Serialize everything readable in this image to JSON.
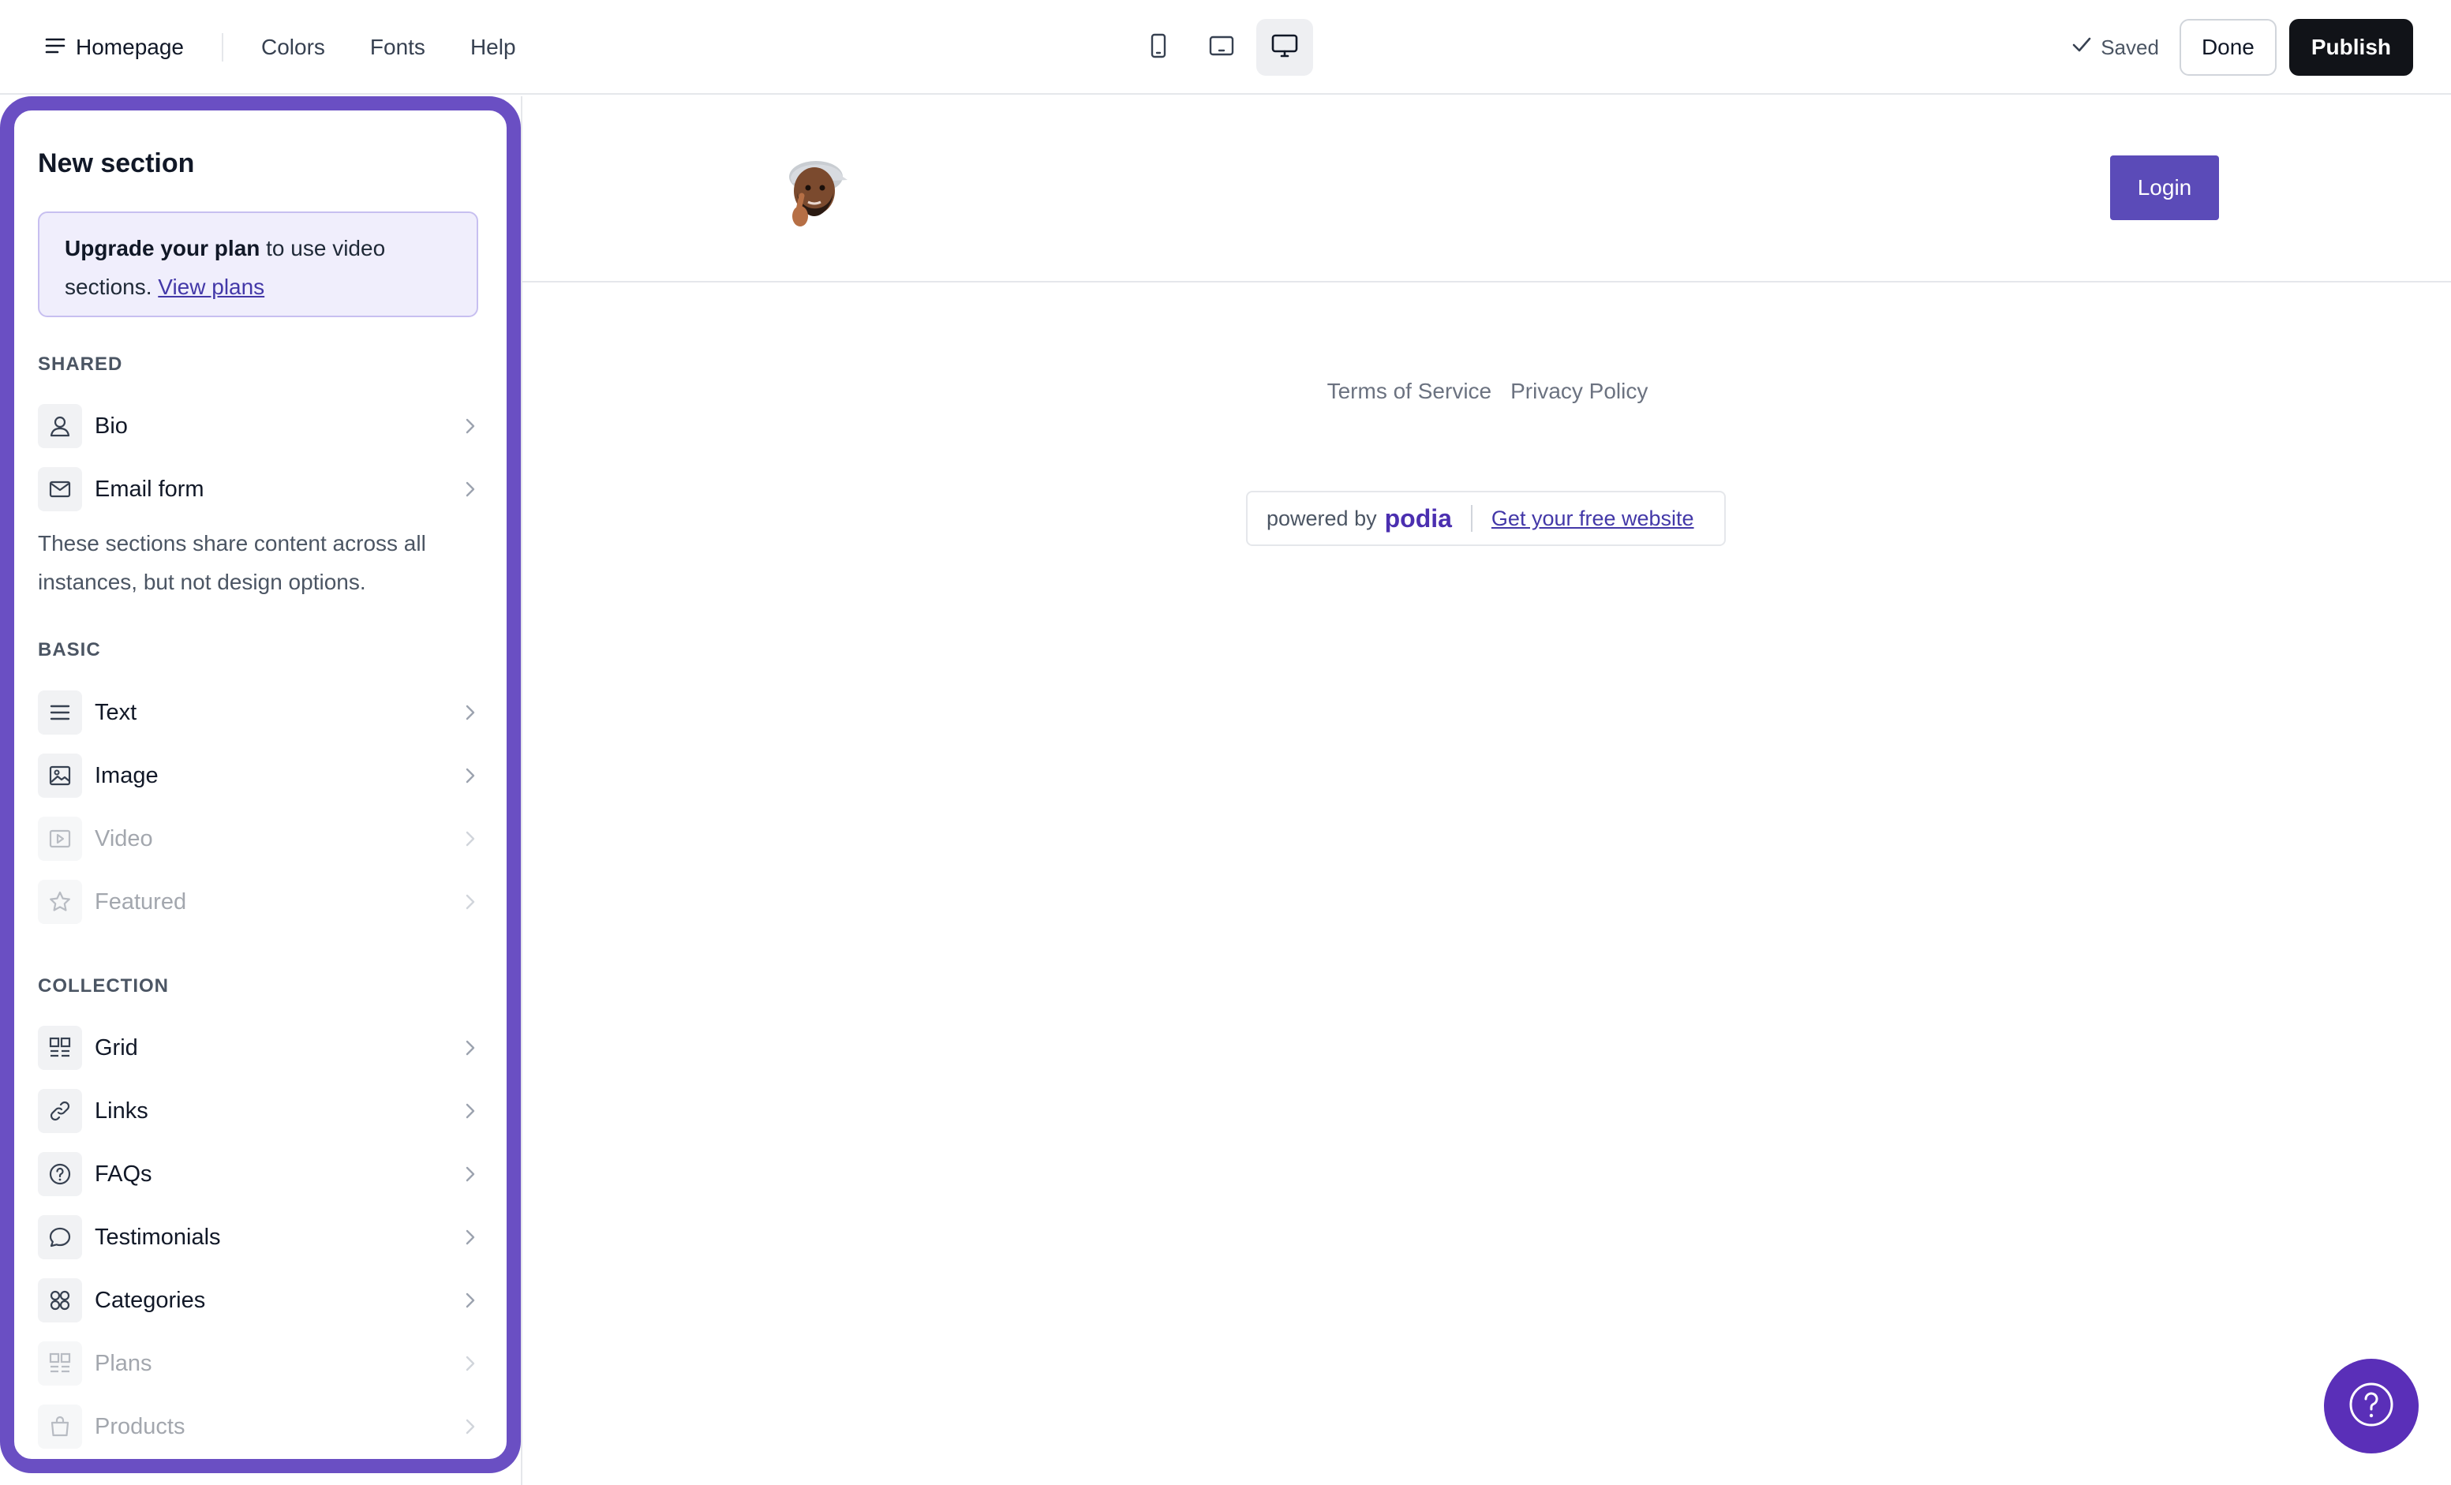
{
  "topbar": {
    "page_name": "Homepage",
    "links": [
      "Colors",
      "Fonts",
      "Help"
    ],
    "devices": [
      "mobile-icon",
      "tablet-icon",
      "desktop-icon"
    ],
    "active_device": "desktop",
    "saved_label": "Saved",
    "done_label": "Done",
    "publish_label": "Publish"
  },
  "panel": {
    "title": "New section",
    "upgrade": {
      "bold": "Upgrade your plan",
      "text": " to use video sections. ",
      "link": "View plans"
    },
    "shared": {
      "heading": "SHARED",
      "items": [
        {
          "label": "Bio",
          "icon": "user-icon",
          "disabled": false
        },
        {
          "label": "Email form",
          "icon": "mail-icon",
          "disabled": false
        }
      ],
      "note": "These sections share content across all instances, but not design options."
    },
    "basic": {
      "heading": "BASIC",
      "items": [
        {
          "label": "Text",
          "icon": "text-lines-icon",
          "disabled": false
        },
        {
          "label": "Image",
          "icon": "image-icon",
          "disabled": false
        },
        {
          "label": "Video",
          "icon": "video-icon",
          "disabled": true
        },
        {
          "label": "Featured",
          "icon": "star-icon",
          "disabled": true
        }
      ]
    },
    "collection": {
      "heading": "COLLECTION",
      "items": [
        {
          "label": "Grid",
          "icon": "grid-icon",
          "disabled": false
        },
        {
          "label": "Links",
          "icon": "link-icon",
          "disabled": false
        },
        {
          "label": "FAQs",
          "icon": "question-circle-icon",
          "disabled": false
        },
        {
          "label": "Testimonials",
          "icon": "speech-bubble-icon",
          "disabled": false
        },
        {
          "label": "Categories",
          "icon": "categories-icon",
          "disabled": false
        },
        {
          "label": "Plans",
          "icon": "grid-icon",
          "disabled": true
        },
        {
          "label": "Products",
          "icon": "shopping-bag-icon",
          "disabled": true
        }
      ]
    }
  },
  "canvas": {
    "login_label": "Login",
    "footer_links": [
      "Terms of Service",
      "Privacy Policy"
    ],
    "powered_by": "powered by",
    "brand": "podia",
    "cta": "Get your free website"
  },
  "colors": {
    "accent": "#6a4fc3",
    "login_bg": "#5b4bb8",
    "publish_bg": "#111318",
    "help_bg": "#5a2fb8"
  }
}
